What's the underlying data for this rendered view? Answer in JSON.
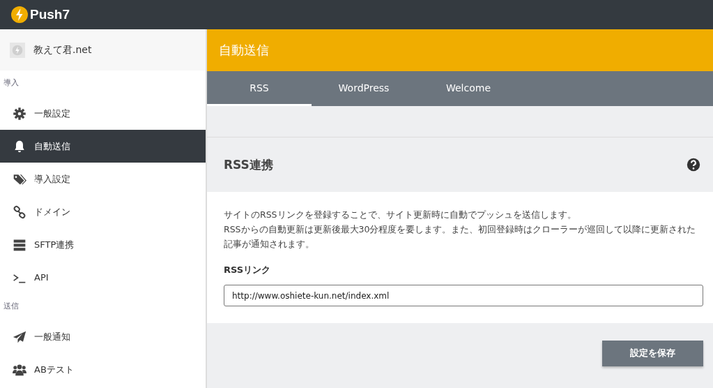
{
  "app": {
    "logo_text": "Push7"
  },
  "sidebar": {
    "account": "教えて君.net",
    "sections": [
      {
        "label": "導入",
        "items": [
          {
            "label": "一般設定",
            "selected": false
          },
          {
            "label": "自動送信",
            "selected": true
          },
          {
            "label": "導入設定",
            "selected": false
          },
          {
            "label": "ドメイン",
            "selected": false
          },
          {
            "label": "SFTP連携",
            "selected": false
          },
          {
            "label": "API",
            "selected": false
          }
        ]
      },
      {
        "label": "送信",
        "items": [
          {
            "label": "一般通知",
            "selected": false
          },
          {
            "label": "ABテスト",
            "selected": false
          }
        ]
      }
    ]
  },
  "page": {
    "title": "自動送信",
    "tabs": [
      {
        "label": "RSS",
        "selected": true
      },
      {
        "label": "WordPress",
        "selected": false
      },
      {
        "label": "Welcome",
        "selected": false
      }
    ],
    "card": {
      "title": "RSS連携",
      "description": [
        "サイトのRSSリンクを登録することで、サイト更新時に自動でプッシュを送信します。",
        "RSSからの自動更新は更新後最大30分程度を要します。また、初回登録時はクローラーが巡回して以降に更新された記事が通知されます。"
      ],
      "field_label": "RSSリンク",
      "field_value": "http://www.oshiete-kun.net/index.xml",
      "save_button": "設定を保存"
    }
  }
}
